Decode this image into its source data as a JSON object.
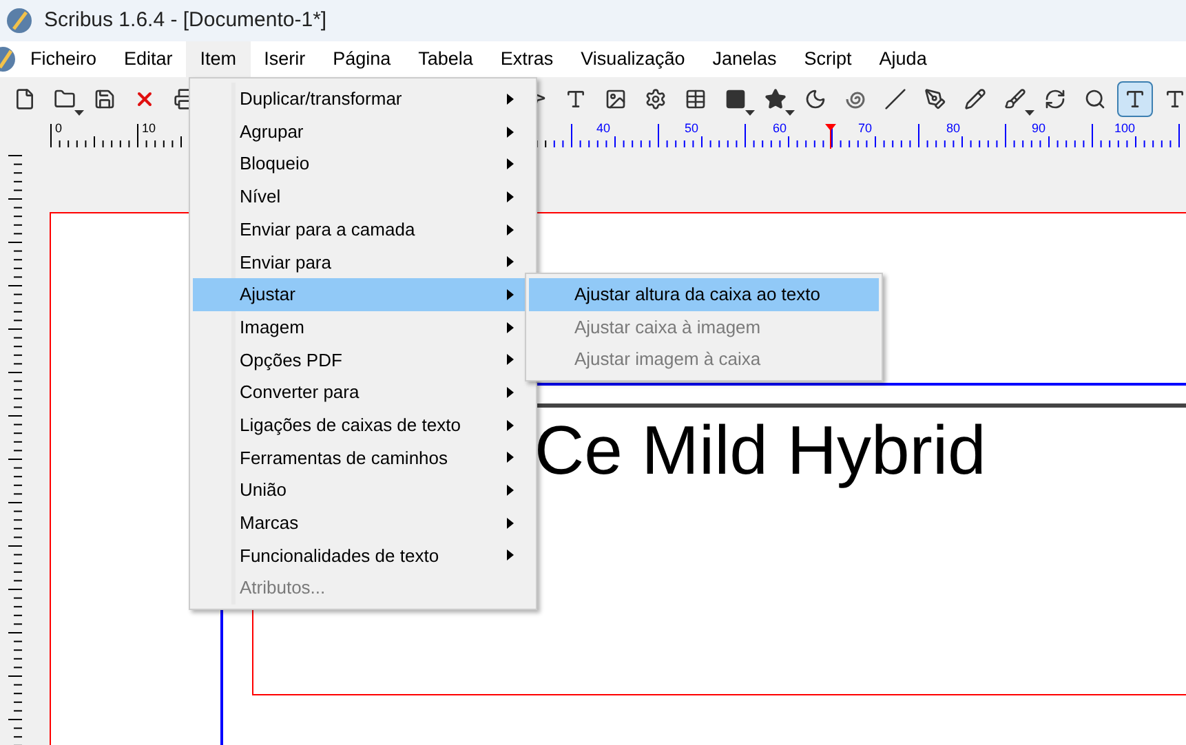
{
  "window": {
    "title": "Scribus 1.6.4 - [Documento-1*]"
  },
  "menubar": [
    {
      "label": "Ficheiro",
      "selected": false
    },
    {
      "label": "Editar",
      "selected": false
    },
    {
      "label": "Item",
      "selected": true
    },
    {
      "label": "Iserir",
      "selected": false
    },
    {
      "label": "Página",
      "selected": false
    },
    {
      "label": "Tabela",
      "selected": false
    },
    {
      "label": "Extras",
      "selected": false
    },
    {
      "label": "Visualização",
      "selected": false
    },
    {
      "label": "Janelas",
      "selected": false
    },
    {
      "label": "Script",
      "selected": false
    },
    {
      "label": "Ajuda",
      "selected": false
    }
  ],
  "toolbar": [
    {
      "kind": "new",
      "selected": false
    },
    {
      "kind": "open",
      "selected": false
    },
    {
      "kind": "save",
      "selected": false
    },
    {
      "kind": "close",
      "selected": false
    },
    {
      "kind": "print",
      "selected": false
    },
    {
      "kind": "select",
      "selected": false
    },
    {
      "kind": "text",
      "selected": false
    },
    {
      "kind": "image",
      "selected": false
    },
    {
      "kind": "render",
      "selected": false
    },
    {
      "kind": "table",
      "selected": false
    },
    {
      "kind": "shape",
      "selected": false
    },
    {
      "kind": "polygon",
      "selected": false
    },
    {
      "kind": "arc",
      "selected": false
    },
    {
      "kind": "spiral",
      "selected": false
    },
    {
      "kind": "line",
      "selected": false
    },
    {
      "kind": "bezier",
      "selected": false
    },
    {
      "kind": "freehand",
      "selected": false
    },
    {
      "kind": "calligraphic",
      "selected": false
    },
    {
      "kind": "rotate",
      "selected": false
    },
    {
      "kind": "zoom",
      "selected": false
    },
    {
      "kind": "edit_text",
      "selected": true
    },
    {
      "kind": "story",
      "selected": false
    }
  ],
  "ruler": {
    "labels": [
      "0",
      "10",
      "40",
      "50",
      "60",
      "70",
      "80",
      "90",
      "100"
    ]
  },
  "canvas": {
    "text": "Ce Mild Hybrid"
  },
  "menu": {
    "items": [
      {
        "label": "Duplicar/transformar",
        "submenu": true,
        "disabled": false,
        "selected": false
      },
      {
        "label": "Agrupar",
        "submenu": true,
        "disabled": false,
        "selected": false
      },
      {
        "label": "Bloqueio",
        "submenu": true,
        "disabled": false,
        "selected": false
      },
      {
        "label": "Nível",
        "submenu": true,
        "disabled": false,
        "selected": false
      },
      {
        "label": "Enviar para a camada",
        "submenu": true,
        "disabled": false,
        "selected": false
      },
      {
        "label": "Enviar para",
        "submenu": true,
        "disabled": false,
        "selected": false
      },
      {
        "label": "Ajustar",
        "submenu": true,
        "disabled": false,
        "selected": true
      },
      {
        "label": "Imagem",
        "submenu": true,
        "disabled": false,
        "selected": false
      },
      {
        "label": "Opções PDF",
        "submenu": true,
        "disabled": false,
        "selected": false
      },
      {
        "label": "Converter para",
        "submenu": true,
        "disabled": false,
        "selected": false
      },
      {
        "label": "Ligações de caixas de texto",
        "submenu": true,
        "disabled": false,
        "selected": false
      },
      {
        "label": "Ferramentas de caminhos",
        "submenu": true,
        "disabled": false,
        "selected": false
      },
      {
        "label": "União",
        "submenu": true,
        "disabled": false,
        "selected": false
      },
      {
        "label": "Marcas",
        "submenu": true,
        "disabled": false,
        "selected": false
      },
      {
        "label": "Funcionalidades de texto",
        "submenu": true,
        "disabled": false,
        "selected": false
      },
      {
        "label": "Atributos...",
        "submenu": false,
        "disabled": true,
        "selected": false
      }
    ]
  },
  "submenu": {
    "items": [
      {
        "label": "Ajustar altura da caixa ao texto",
        "disabled": false,
        "selected": true
      },
      {
        "label": "Ajustar caixa à imagem",
        "disabled": true,
        "selected": false
      },
      {
        "label": "Ajustar imagem à caixa",
        "disabled": true,
        "selected": false
      }
    ]
  }
}
